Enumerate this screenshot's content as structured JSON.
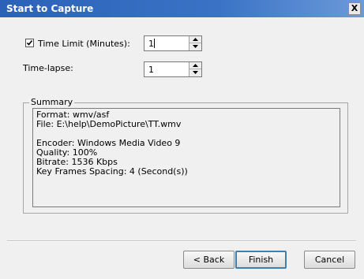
{
  "window": {
    "title": "Start to Capture",
    "close_glyph": "X"
  },
  "time_limit": {
    "checked": true,
    "label": "Time Limit (Minutes):",
    "value": "1"
  },
  "time_lapse": {
    "label": "Time-lapse:",
    "value": "1"
  },
  "summary": {
    "label": "Summary",
    "lines": [
      "Format: wmv/asf",
      "File:  E:\\help\\DemoPicture\\TT.wmv",
      "",
      "Encoder: Windows Media Video 9",
      "Quality: 100%",
      "Bitrate:   1536 Kbps",
      "Key Frames Spacing: 4 (Second(s))"
    ]
  },
  "buttons": {
    "back": "< Back",
    "finish": "Finish",
    "cancel": "Cancel"
  },
  "icons": {
    "checkbox_mark": "checkmark-icon",
    "spin_up": "arrow-up-icon",
    "spin_down": "arrow-down-icon"
  }
}
